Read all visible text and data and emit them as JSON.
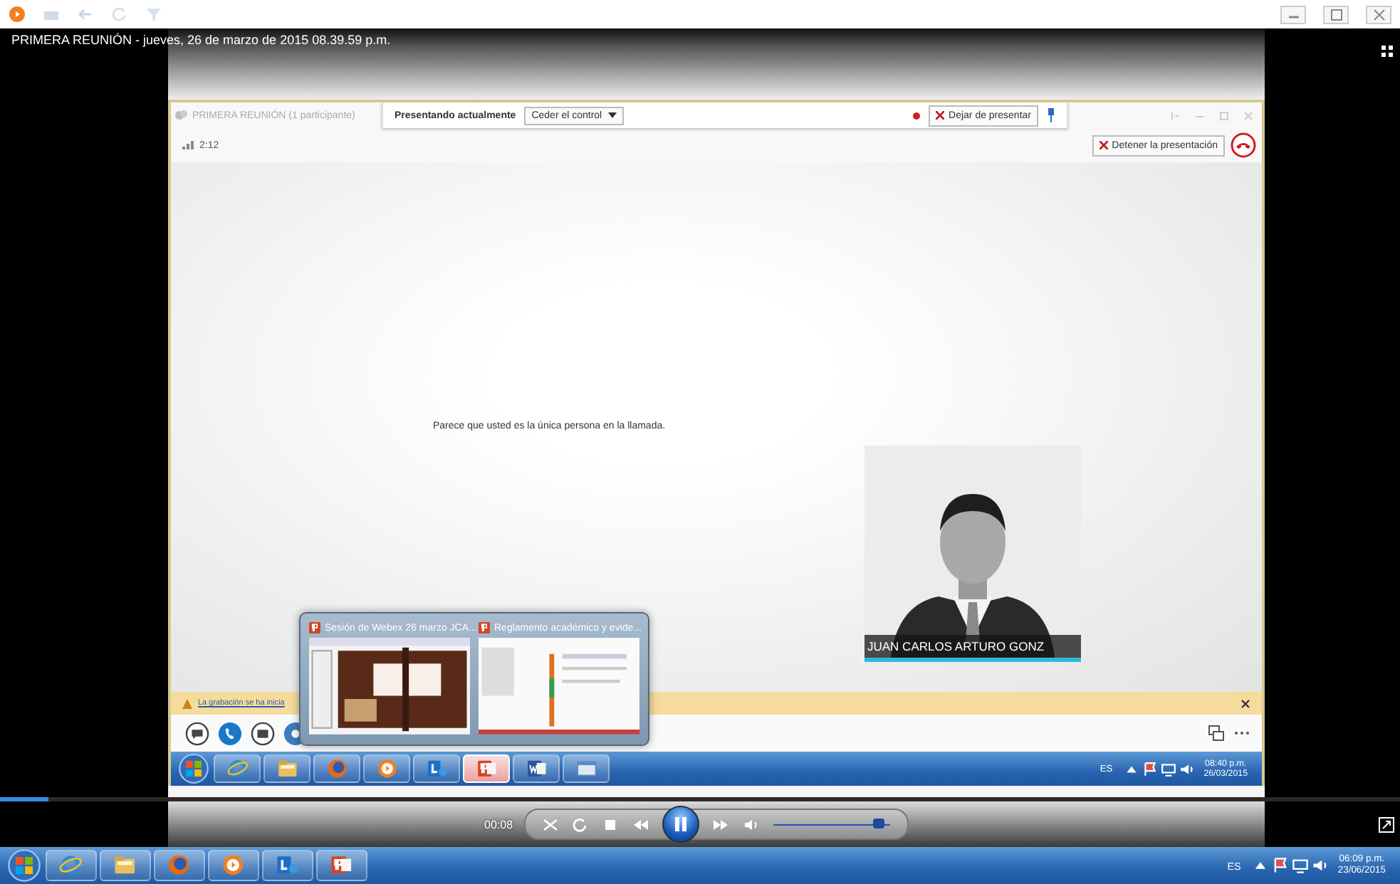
{
  "player": {
    "title": "PRIMERA REUNIÓN - jueves, 26 de marzo de 2015 08.39.59 p.m.",
    "time": "00:08",
    "playing": true,
    "progress": {
      "level": 0.035
    },
    "volume": {
      "level": 0.9
    }
  },
  "meeting": {
    "title": "PRIMERA REUNIÓN (1 participante)",
    "presenting_label": "Presentando actualmente",
    "control_dropdown": "Ceder el control",
    "stop_presenting": "Dejar de presentar",
    "duration": "2:12",
    "stop_presentation": "Detener la presentación",
    "message": "Parece que usted es la única persona en la llamada.",
    "participant": {
      "name": "JUAN CARLOS ARTURO GONZ"
    },
    "notification": "La grabación se ha inicia"
  },
  "thumbnails": [
    {
      "title": "Sesión de Webex 26 marzo JCA..."
    },
    {
      "title": "Reglamento académico y evide..."
    }
  ],
  "inner_taskbar": {
    "apps": [
      {
        "kind": "ie",
        "active": false
      },
      {
        "kind": "explorer",
        "active": false
      },
      {
        "kind": "firefox",
        "active": false
      },
      {
        "kind": "media",
        "active": false
      },
      {
        "kind": "lync",
        "active": false
      },
      {
        "kind": "powerpoint",
        "active": true
      },
      {
        "kind": "word",
        "active": false
      },
      {
        "kind": "window",
        "active": false
      }
    ],
    "language": "ES",
    "time": "08:40 p.m.",
    "date": "26/03/2015"
  },
  "taskbar": {
    "apps": [
      {
        "kind": "ie",
        "active": false
      },
      {
        "kind": "explorer",
        "active": false
      },
      {
        "kind": "firefox",
        "active": false
      },
      {
        "kind": "media",
        "active": false
      },
      {
        "kind": "lync",
        "active": false
      },
      {
        "kind": "powerpoint",
        "active": false
      }
    ],
    "language": "ES",
    "time": "06:09 p.m.",
    "date": "23/06/2015"
  }
}
